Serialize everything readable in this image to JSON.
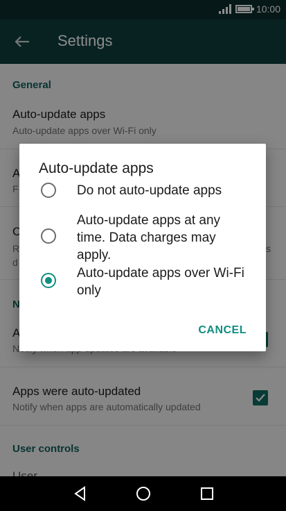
{
  "status": {
    "time": "10:00",
    "battery_level": 0.9
  },
  "toolbar": {
    "title": "Settings"
  },
  "settings": {
    "section_general": "General",
    "auto_update": {
      "title": "Auto-update apps",
      "subtitle": "Auto-update apps over Wi-Fi only"
    },
    "row2": {
      "title_initial": "A",
      "subtitle_initial": "F"
    },
    "row3": {
      "title_initial": "C",
      "line2_initial": "R",
      "line3_initial": "d",
      "trailing": "s"
    },
    "section_n_initial": "N",
    "row4": {
      "title_initial": "A",
      "subtitle_partial": "Notify when app updates are available"
    },
    "apps_updated": {
      "title": "Apps were auto-updated",
      "subtitle": "Notify when apps are automatically updated",
      "checked": true
    },
    "section_user_controls": "User controls",
    "cut_off_item": "User ..."
  },
  "dialog": {
    "title": "Auto-update apps",
    "options": [
      {
        "label": "Do not auto-update apps",
        "selected": false
      },
      {
        "label": "Auto-update apps at any time. Data charges may apply.",
        "selected": false
      },
      {
        "label": "Auto-update apps over Wi-Fi only",
        "selected": true
      }
    ],
    "cancel": "CANCEL"
  },
  "colors": {
    "accent": "#0f8e80",
    "toolbar": "#0f3f3f",
    "statusbar": "#0b2c2c"
  },
  "icons": {
    "back": "arrow-left",
    "nav_back": "triangle-back",
    "nav_home": "circle-home",
    "nav_recents": "square-recents"
  }
}
